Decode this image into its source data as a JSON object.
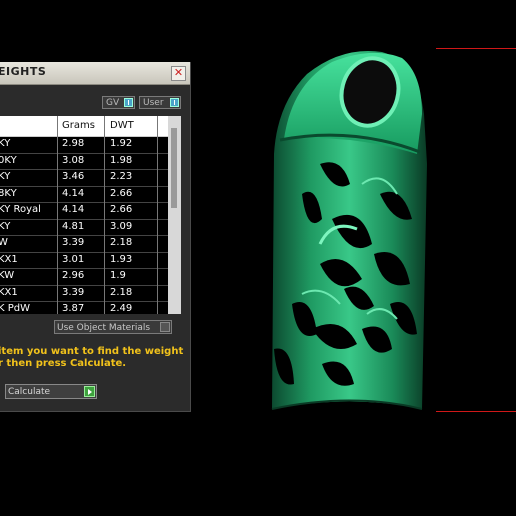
{
  "window": {
    "title": "EIGHTS"
  },
  "toggles": {
    "gv_label": "GV",
    "user_label": "User"
  },
  "table": {
    "headers": [
      "",
      "Grams",
      "DWT"
    ],
    "rows": [
      {
        "name": "KY",
        "grams": "2.98",
        "dwt": "1.92"
      },
      {
        "name": "0KY",
        "grams": "3.08",
        "dwt": "1.98"
      },
      {
        "name": "KY",
        "grams": "3.46",
        "dwt": "2.23"
      },
      {
        "name": "8KY",
        "grams": "4.14",
        "dwt": "2.66"
      },
      {
        "name": "KY Royal",
        "grams": "4.14",
        "dwt": "2.66"
      },
      {
        "name": "KY",
        "grams": "4.81",
        "dwt": "3.09"
      },
      {
        "name": "W",
        "grams": "3.39",
        "dwt": "2.18"
      },
      {
        "name": "KX1",
        "grams": "3.01",
        "dwt": "1.93"
      },
      {
        "name": "KW",
        "grams": "2.96",
        "dwt": "1.9"
      },
      {
        "name": "KX1",
        "grams": "3.39",
        "dwt": "2.18"
      },
      {
        "name": "K PdW",
        "grams": "3.87",
        "dwt": "2.49"
      }
    ]
  },
  "use_object_materials_label": "Use Object Materials",
  "instructions": {
    "line1": "item you want to find the weight",
    "line2": "r then press Calculate."
  },
  "calculate_label": "Calculate",
  "colors": {
    "model": "#1fa56a",
    "guide": "#d01818",
    "instruction_text": "#f1c21b"
  }
}
